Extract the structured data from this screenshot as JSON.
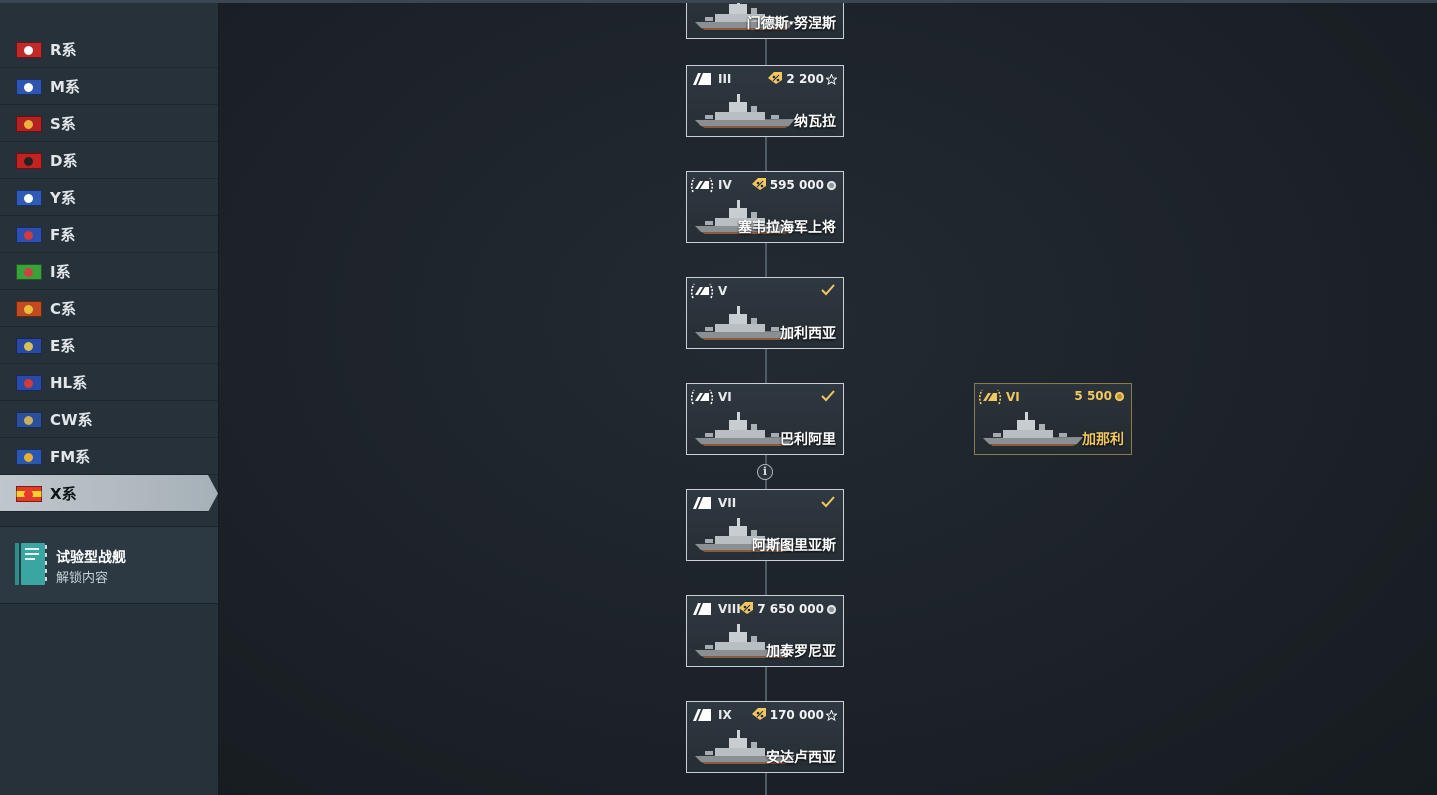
{
  "sidebar": {
    "nations": [
      {
        "label": "R系",
        "flag_color": "#c22a2a",
        "emblem_color": "#ffffff"
      },
      {
        "label": "M系",
        "flag_color": "#2f55b3",
        "emblem_color": "#ffffff"
      },
      {
        "label": "S系",
        "flag_color": "#b52020",
        "emblem_color": "#e8b43a"
      },
      {
        "label": "D系",
        "flag_color": "#c22222",
        "emblem_color": "#222222"
      },
      {
        "label": "Y系",
        "flag_color": "#2f5bb8",
        "emblem_color": "#ffffff"
      },
      {
        "label": "F系",
        "flag_color": "#2c4fb0",
        "emblem_color": "#d63a3a"
      },
      {
        "label": "I系",
        "flag_color": "#3aa23a",
        "emblem_color": "#d44040"
      },
      {
        "label": "C系",
        "flag_color": "#c24a20",
        "emblem_color": "#e8c040"
      },
      {
        "label": "E系",
        "flag_color": "#2a4aa0",
        "emblem_color": "#d8c05a"
      },
      {
        "label": "HL系",
        "flag_color": "#2a4aa8",
        "emblem_color": "#d43a3a"
      },
      {
        "label": "CW系",
        "flag_color": "#2c4f9a",
        "emblem_color": "#c8b060"
      },
      {
        "label": "FM系",
        "flag_color": "#2a58b0",
        "emblem_color": "#e8b030"
      },
      {
        "label": "X系",
        "flag_color": "#e33a2a",
        "emblem_color": "#f5d030"
      }
    ],
    "selected_index": 12,
    "experimental": {
      "title": "试验型战舰",
      "subtitle": "解锁内容"
    }
  },
  "colors": {
    "gold": "#f1c760",
    "card_border": "#c9cfd3",
    "premium_border": "#8a7a4c",
    "check": "#f1c760"
  },
  "tree": {
    "main_line": [
      {
        "name": "门德斯·努涅斯",
        "tier": "",
        "price": "",
        "currency": "",
        "researched": false,
        "elite": false,
        "partial": true
      },
      {
        "name": "纳瓦拉",
        "tier": "III",
        "price": "2 200",
        "currency": "xp-star-icon",
        "discount": true,
        "researched": false,
        "elite": false
      },
      {
        "name": "塞韦拉海军上将",
        "tier": "IV",
        "price": "595 000",
        "currency": "credits-icon",
        "discount": true,
        "researched": false,
        "elite": true
      },
      {
        "name": "加利西亚",
        "tier": "V",
        "price": "",
        "currency": "",
        "researched": true,
        "elite": true
      },
      {
        "name": "巴利阿里",
        "tier": "VI",
        "price": "",
        "currency": "",
        "researched": true,
        "elite": true
      },
      {
        "name": "阿斯图里亚斯",
        "tier": "VII",
        "price": "",
        "currency": "",
        "researched": true,
        "elite": false
      },
      {
        "name": "加泰罗尼亚",
        "tier": "VIII",
        "price": "7 650 000",
        "currency": "credits-icon",
        "discount": true,
        "researched": false,
        "elite": false
      },
      {
        "name": "安达卢西亚",
        "tier": "IX",
        "price": "170 000",
        "currency": "xp-star-icon",
        "discount": true,
        "researched": false,
        "elite": false
      }
    ],
    "premium": [
      {
        "name": "加那利",
        "tier": "VI",
        "price": "5 500",
        "currency": "doubloons-icon",
        "elite": true
      }
    ],
    "info_glyph": "i"
  }
}
